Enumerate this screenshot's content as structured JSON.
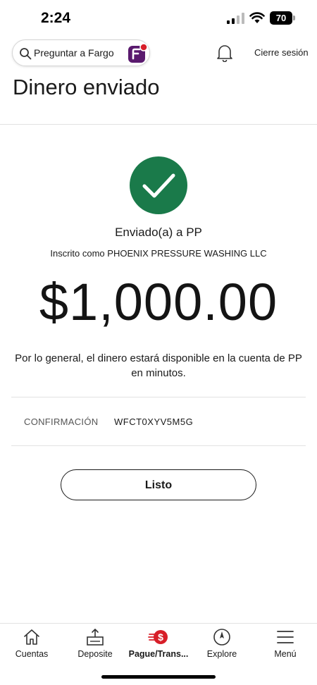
{
  "status_bar": {
    "time": "2:24",
    "battery": "70"
  },
  "header": {
    "search_text": "Preguntar a Fargo",
    "logout": "Cierre sesión"
  },
  "page": {
    "title": "Dinero enviado"
  },
  "confirmation": {
    "sent_to": "Enviado(a) a PP",
    "enrolled_as": "Inscrito como PHOENIX PRESSURE WASHING LLC",
    "amount": "$1,000.00",
    "availability": "Por lo general, el dinero estará disponible en la cuenta de PP en minutos.",
    "conf_label": "CONFIRMACIÓN",
    "conf_value": "WFCT0XYV5M5G",
    "done_label": "Listo"
  },
  "bottom_nav": {
    "items": [
      {
        "label": "Cuentas",
        "icon": "house-icon"
      },
      {
        "label": "Deposite",
        "icon": "deposit-icon"
      },
      {
        "label": "Pague/Trans...",
        "icon": "pay-transfer-icon",
        "active": true
      },
      {
        "label": "Explore",
        "icon": "compass-icon"
      },
      {
        "label": "Menú",
        "icon": "menu-icon"
      }
    ]
  },
  "colors": {
    "success_green": "#1a7a4a",
    "brand_red": "#d71e28",
    "brand_purple": "#5a1a6e"
  }
}
